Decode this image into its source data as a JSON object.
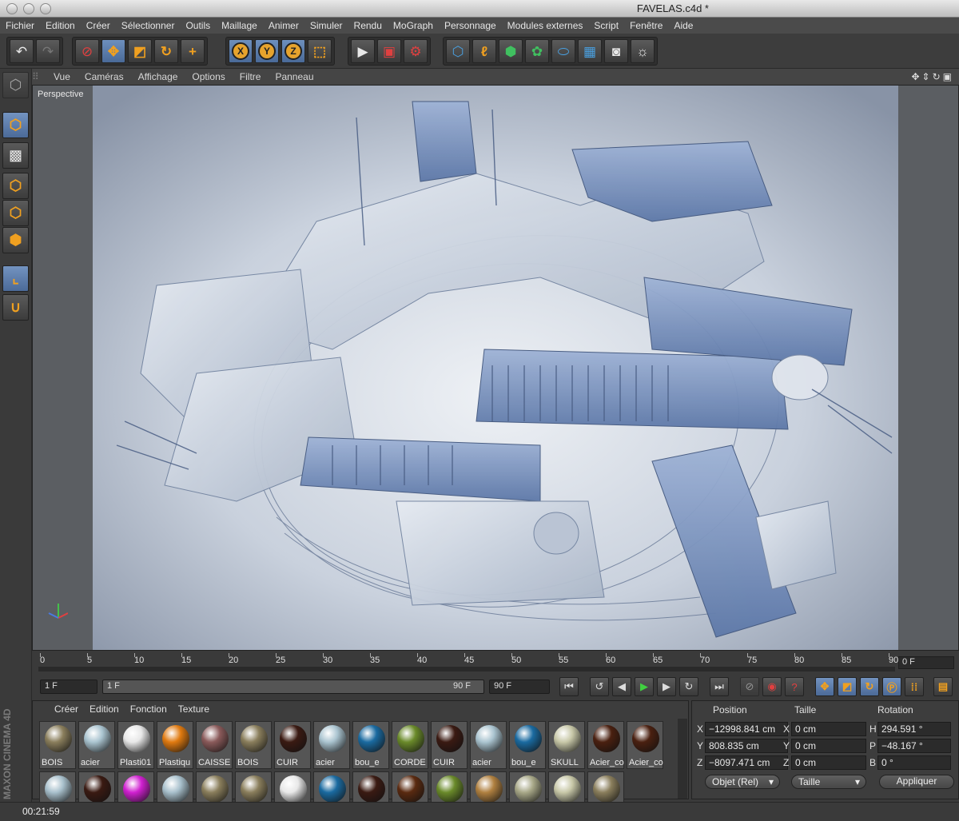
{
  "window": {
    "title": "FAVELAS.c4d *"
  },
  "menubar": [
    "Fichier",
    "Edition",
    "Créer",
    "Sélectionner",
    "Outils",
    "Maillage",
    "Animer",
    "Simuler",
    "Rendu",
    "MoGraph",
    "Personnage",
    "Modules externes",
    "Script",
    "Fenêtre",
    "Aide"
  ],
  "toolbar": {
    "undo": "undo-icon",
    "redo": "redo-icon",
    "axes": [
      "X",
      "Y",
      "Z"
    ]
  },
  "viewport": {
    "menu": [
      "Vue",
      "Caméras",
      "Affichage",
      "Options",
      "Filtre",
      "Panneau"
    ],
    "label": "Perspective"
  },
  "timeline": {
    "ticks": [
      "0",
      "5",
      "10",
      "15",
      "20",
      "25",
      "30",
      "35",
      "40",
      "45",
      "50",
      "55",
      "60",
      "65",
      "70",
      "75",
      "80",
      "85",
      "90"
    ],
    "current_frame": "0 F",
    "start": "1 F",
    "range_start": "1 F",
    "range_end": "90 F",
    "end": "90 F"
  },
  "materials": {
    "menu": [
      "Créer",
      "Edition",
      "Fonction",
      "Texture"
    ],
    "row1": [
      {
        "label": "BOIS",
        "color": "#8a7e5c"
      },
      {
        "label": "acier",
        "color": "#aac4d0"
      },
      {
        "label": "Plasti01",
        "color": "#e8e8e8"
      },
      {
        "label": "Plastiqu",
        "color": "#e07a10"
      },
      {
        "label": "CAISSE",
        "color": "#8a5a5a"
      },
      {
        "label": "BOIS",
        "color": "#8a7e5c"
      },
      {
        "label": "CUIR",
        "color": "#3a1a12"
      },
      {
        "label": "acier",
        "color": "#aac4d0"
      },
      {
        "label": "bou_e",
        "color": "#1a6aa0"
      },
      {
        "label": "CORDE",
        "color": "#6a8a2a"
      },
      {
        "label": "CUIR",
        "color": "#3a1a12"
      },
      {
        "label": "acier",
        "color": "#aac4d0"
      },
      {
        "label": "bou_e",
        "color": "#1a6aa0"
      },
      {
        "label": "SKULL",
        "color": "#c8c8a8"
      },
      {
        "label": "Acier_co",
        "color": "#4a2010"
      },
      {
        "label": "Acier_co",
        "color": "#4a2010"
      }
    ],
    "row2": [
      {
        "color": "#a8c0cc"
      },
      {
        "color": "#3a1a12"
      },
      {
        "color": "#d020d0"
      },
      {
        "color": "#a8c0cc"
      },
      {
        "color": "#8a7e5c"
      },
      {
        "color": "#8a7e5c"
      },
      {
        "color": "#e8e8e8"
      },
      {
        "color": "#1a6aa0"
      },
      {
        "color": "#3a1a12"
      },
      {
        "color": "#5a2a10"
      },
      {
        "color": "#6a8a2a"
      },
      {
        "color": "#b08040"
      },
      {
        "color": "#a8a888"
      },
      {
        "color": "#c8c8a8"
      },
      {
        "color": "#8a7e5c"
      }
    ]
  },
  "coordinates": {
    "headers": [
      "Position",
      "Taille",
      "Rotation"
    ],
    "rows": [
      {
        "pl": "X",
        "pos": "−12998.841 cm",
        "sl": "X",
        "size": "0 cm",
        "rl": "H",
        "rot": "294.591 °"
      },
      {
        "pl": "Y",
        "pos": "808.835 cm",
        "sl": "Y",
        "size": "0 cm",
        "rl": "P",
        "rot": "−48.167 °"
      },
      {
        "pl": "Z",
        "pos": "−8097.471 cm",
        "sl": "Z",
        "size": "0 cm",
        "rl": "B",
        "rot": "0 °"
      }
    ],
    "mode": "Objet (Rel)",
    "size_mode": "Taille",
    "apply": "Appliquer"
  },
  "status": {
    "time": "00:21:59"
  },
  "brand": "MAXON CINEMA 4D"
}
